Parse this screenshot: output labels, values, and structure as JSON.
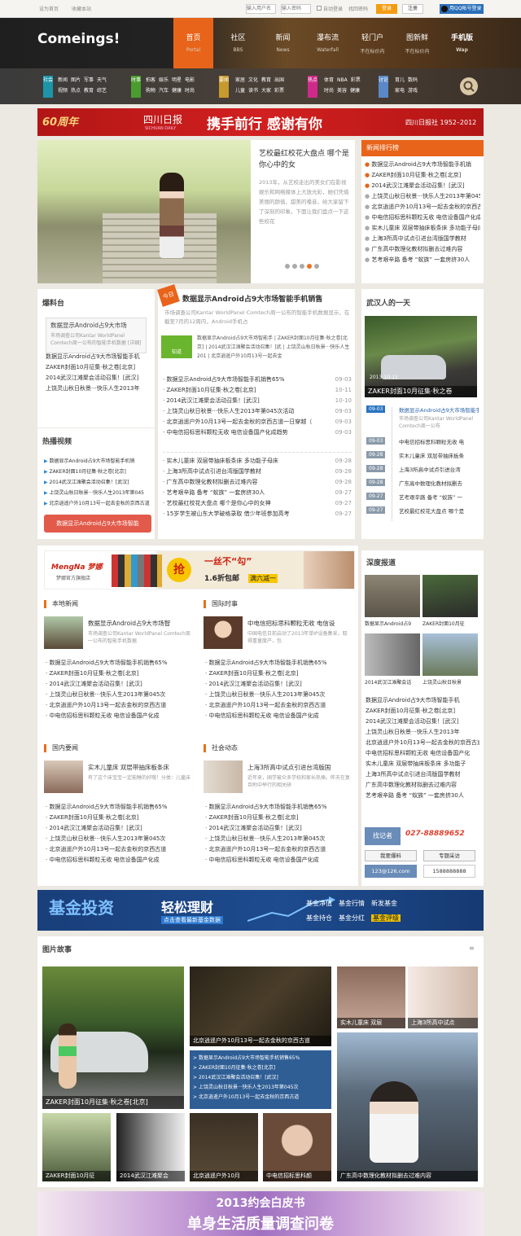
{
  "topbar": {
    "sethome": "设为首页",
    "bookmark": "收藏本站",
    "user_ph": "输入用户名",
    "pass_ph": "输入密码",
    "auto": "自动登录",
    "forgot": "找回密码",
    "login": "登录",
    "register": "注册",
    "qq": "用QQ帐号登录"
  },
  "logo": "Comeings!",
  "nav": [
    {
      "cn": "首页",
      "en": "Portal"
    },
    {
      "cn": "社区",
      "en": "BBS"
    },
    {
      "cn": "新闻",
      "en": "News"
    },
    {
      "cn": "瀑布流",
      "en": "Waterfall"
    },
    {
      "cn": "轻门户",
      "en": "不在标价内"
    },
    {
      "cn": "图新鲜",
      "en": "不在标价内"
    },
    {
      "cn": "手机版",
      "en": "Wap"
    }
  ],
  "cats": [
    {
      "label": "社会",
      "color": "#1d95a8",
      "links": [
        "新闻",
        "图片",
        "军事",
        "天气",
        "视频",
        "热点",
        "教育",
        "综艺"
      ]
    },
    {
      "label": "时事",
      "color": "#4a9c2e",
      "links": [
        "拍客",
        "娱乐",
        "明星",
        "电影",
        "购物",
        "汽车",
        "健康",
        "时尚"
      ]
    },
    {
      "label": "要闻",
      "color": "#c79a2d",
      "links": [
        "家居",
        "文化",
        "教育",
        "出国",
        "儿童",
        "读书",
        "大家",
        "彩票"
      ]
    },
    {
      "label": "热点",
      "color": "#cf2a8a",
      "links": [
        "体育",
        "NBA",
        "彩票",
        "时尚",
        "美容",
        "健康"
      ]
    },
    {
      "label": "讨论",
      "color": "#5a88c8",
      "links": [
        "育儿",
        "数码",
        "家电",
        "游戏"
      ]
    }
  ],
  "banner1": {
    "sixty": "60周年",
    "paper": "四川日报",
    "paper_en": "SICHUAN DAILY",
    "slogan": "携手前行 感谢有你",
    "right": "四川日报社 1952–2012"
  },
  "feature": {
    "title": "艺校最红校花大盘点 哪个是你心中的女",
    "text": "2013年，从艺校走出的美女们在影视娱乐和网络媒体上大放光彩，她们凭借美丽的颜值、甜美的嗓音，给大家留下了深刻的印象。下面让我们盘点一下这些校花"
  },
  "ranking": {
    "title": "新闻排行榜",
    "items": [
      "数据显示Android占9大市场智能手机销",
      "ZAKER封面10月征集·秋之卷[北京]",
      "2014武汉江滩聚会活动召集！[武汉]",
      "上饶灵山秋日秋景···快乐人生2013年第045",
      "北京逍遥户外10月13号一起去金秋的京西古道",
      "中电信招标思科颗粒无收 电信设备国产化成趋",
      "实木儿童床 双层带抽床板条床 多功能子母床",
      "上海3所高中试点引进台湾版国学教材",
      "广东高中数理化教材拟删去过难内容",
      "艺考艰辛路 备考 “蚁族” 一套房挤30人"
    ]
  },
  "baoliao": {
    "title": "爆料台",
    "box_title": "数据显示Android占9大市场",
    "box_text": "市场调查公司Kantar WorldPanel Comtech周一公布的智能手机数据 [详细]",
    "links": [
      "数据显示Android占9大市场智能手机",
      "ZAKER封面10月征集·秋之卷[北京]",
      "2014武汉江滩聚会活动召集！[武汉]",
      "上饶灵山秋日秋景···快乐人生2013年"
    ]
  },
  "hot_video": {
    "title": "热播视频",
    "items": [
      "数据显示Android占9大市场智能手机销",
      "ZAKER封面10月征集·秋之卷[北京]",
      "2014武汉江滩聚会活动召集！[武汉]",
      "上饶灵山秋日秋景···快乐人生2013年第045",
      "北京逍遥户外10月13号一起去金秋的京西古道"
    ],
    "button": "数据显示Android占9大市场智能"
  },
  "today": {
    "tag": "今日",
    "headline": "数据显示Android占9大市场智能手机销售",
    "summary": "市场调查公司Kantar WorldPanel Comtech周一公布的智能手机数据显示，在截至7月的12周内，Android手机占",
    "zhidao": "知道",
    "mini": "数据显示Android占9大市场智能手 | ZAKER封面10月征集·秋之卷[北京] | 2014武汉江滩聚会活动召集！[武 | 上饶灵山秋日秋景···快乐人生201 | 北京逍遥户外10月13号一起去金",
    "news1": [
      [
        "数据显示Android占9大市场智能手机销售65%",
        "09-03"
      ],
      [
        "ZAKER封面10月征集·秋之卷[北京]",
        "10-11"
      ],
      [
        "2014武汉江滩聚会活动召集！[武汉]",
        "10-10"
      ],
      [
        "上饶灵山秋日秋景···快乐人生2013年第045次活动",
        "09-03"
      ],
      [
        "北京逍遥户外10月13号一起去金秋的京西古道一日穿越（",
        "09-03"
      ],
      [
        "中电信招标思科颗粒无收 电信设备国产化成趋势",
        "09-03"
      ]
    ],
    "news2": [
      [
        "实木儿童床 双层带抽床板条床 多功能子母床",
        "09-28"
      ],
      [
        "上海3所高中试点引进台湾版国学教材",
        "09-28"
      ],
      [
        "广东高中数理化教材拟删去过难内容",
        "09-28"
      ],
      [
        "艺考艰辛路 备考 “蚁族” 一套房挤30人",
        "09-27"
      ],
      [
        "艺校最红校花大盘点 哪个是你心中的女神",
        "09-27"
      ],
      [
        "15岁学生被山东大学破格录取 借少年班参加高考",
        "09-27"
      ]
    ]
  },
  "wuhan": {
    "title": "武汉人的一天",
    "date": "2013-10-11",
    "caption": "ZAKER封面10月征集·秋之卷",
    "timeline": [
      [
        "09-03",
        "数据显示Android占9大市场智能手机销售",
        "市场调查公司Kantar WorldPanel Comtech周一公布"
      ],
      [
        "09-03",
        "中电信招标思科颗粒无收 电"
      ],
      [
        "09-28",
        "实木儿童床 双层带抽床板条"
      ],
      [
        "09-28",
        "上海3所高中试点引进台湾"
      ],
      [
        "09-28",
        "广东高中数理化教材拟删去"
      ],
      [
        "09-27",
        "艺考艰辛路 备考 “蚁族” 一"
      ],
      [
        "09-27",
        "艺校最红校花大盘点 哪个是"
      ]
    ]
  },
  "ad2": {
    "brand": "MengNa 梦娜",
    "shop": "梦娜官方旗舰店",
    "grab": "抢",
    "slogan": "一丝不“勾”",
    "price": "1.6折包邮",
    "promo": "满六减一"
  },
  "sections": [
    {
      "title": "本地新闻",
      "lead_title": "数据显示Android占9大市场智",
      "lead_text": "市场调查公司Kantar WorldPanel Comtech周一公布的智能手机数据",
      "items": [
        "数据显示Android占9大市场智能手机销售65%",
        "ZAKER封面10月征集·秋之卷[北京]",
        "2014武汉江滩聚会活动召集！[武汉]",
        "上饶灵山秋日秋景···快乐人生2013年第045次",
        "北京逍遥户外10月13号一起去金秋的京西古道",
        "中电信招标思科颗粒无收 电信设备国产化成"
      ]
    },
    {
      "title": "国际时事",
      "lead_title": "中电信招标思科颗粒无收 电信设",
      "lead_text": "中国电信日前启动了2013年单IP设备集采，取得重量度产，包",
      "items": [
        "数据显示Android占9大市场智能手机销售65%",
        "ZAKER封面10月征集·秋之卷[北京]",
        "2014武汉江滩聚会活动召集！[武汉]",
        "上饶灵山秋日秋景···快乐人生2013年第045次",
        "北京逍遥户外10月13号一起去金秋的京西古道",
        "中电信招标思科颗粒无收 电信设备国产化成"
      ]
    },
    {
      "title": "国内要闻",
      "lead_title": "实木儿童床 双层带抽床板条床",
      "lead_text": "有了这个床宝宝一定能睡的好哦！分类：儿童床",
      "items": [
        "数据显示Android占9大市场智能手机销售65%",
        "ZAKER封面10月征集·秋之卷[北京]",
        "2014武汉江滩聚会活动召集！[武汉]",
        "上饶灵山秋日秋景···快乐人生2013年第045次",
        "北京逍遥户外10月13号一起去金秋的京西古道",
        "中电信招标思科颗粒无收 电信设备国产化成"
      ]
    },
    {
      "title": "社会动态",
      "lead_title": "上海3所高中试点引进台湾版国",
      "lead_text": "近年来，国学被众多学校和家长热捧。昨天在复旦附中举行的相关研",
      "items": [
        "数据显示Android占9大市场智能手机销售65%",
        "ZAKER封面10月征集·秋之卷[北京]",
        "2014武汉江滩聚会活动召集！[武汉]",
        "上饶灵山秋日秋景···快乐人生2013年第045次",
        "北京逍遥户外10月13号一起去金秋的京西古道",
        "中电信招标思科颗粒无收 电信设备国产化成"
      ]
    }
  ],
  "deep": {
    "title": "深度报道",
    "thumbs": [
      "数据显示Android占9",
      "ZAKER封面10月征",
      "2014武汉江滩聚会话",
      "上饶灵山秋日秋景"
    ],
    "links": [
      "数据显示Android占9大市场智能手机",
      "ZAKER封面10月征集·秋之卷[北京]",
      "2014武汉江滩聚会活动召集！[武汉]",
      "上饶灵山秋日秋景···快乐人生2013年",
      "北京逍遥户外10月13号一起去金秋的京西古道",
      "中电信招标思科颗粒无收 电信设备国产化",
      "实木儿童床 双层带抽床板条床 多功能子",
      "上海3所高中试点引进台湾版国学教材",
      "广东高中数理化教材拟删去过难内容",
      "艺考艰辛路 备考 “蚁族” 一套房挤30人"
    ]
  },
  "reporter": {
    "label": "找记者",
    "phone": "027-88889652",
    "b1": "我要爆料",
    "b2": "专题采访",
    "email": "123@126.com",
    "tel": "1588888888"
  },
  "fund": {
    "t1": "基金投资",
    "t2": "轻松理财",
    "sub": "点击查看最新基金数据",
    "links": [
      "基金净值",
      "基金行情",
      "新发基金",
      "基金持仓",
      "基金分红",
      "基金评级"
    ]
  },
  "photo": {
    "title": "图片故事",
    "c1": "ZAKER封面10月征集·秋之卷[北京]",
    "c2": "北京逍遥户外10月13号一起去金秋的京西古道",
    "list": [
      "数据显示Android占9大市场智能手机销售65%",
      "ZAKER封面10月征集·秋之卷[北京]",
      "2014武汉江滩聚会活动召集！[武汉]",
      "上饶灵山秋日秋景···快乐人生2013年第045次",
      "北京逍遥户外10月13号一起去金秋的京西古道"
    ],
    "c3": "实木儿童床 双层",
    "c4": "上海3所高中试点",
    "c5": "ZAKER封面10月征",
    "c6": "2014武汉江滩聚会",
    "c7": "北京逍遥户外10月",
    "c8": "中电信招标思科颜",
    "c9": "广东高中数理化教材拟删去过难内容"
  },
  "bottom_ad": {
    "l1": "2013约会白皮书",
    "l2": "单身生活质量调查问卷"
  }
}
